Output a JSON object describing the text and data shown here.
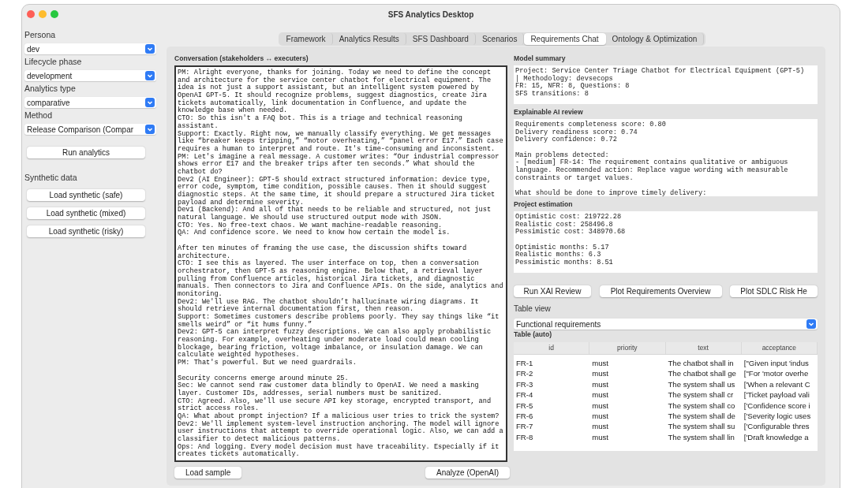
{
  "window": {
    "title": "SFS Analytics Desktop"
  },
  "sidebar": {
    "fields": [
      {
        "label": "Persona",
        "value": "dev"
      },
      {
        "label": "Lifecycle phase",
        "value": "development"
      },
      {
        "label": "Analytics type",
        "value": "comparative"
      },
      {
        "label": "Method",
        "value": "Release Comparison (Compar"
      }
    ],
    "run_button": "Run analytics",
    "synthetic": {
      "label": "Synthetic data",
      "buttons": [
        "Load synthetic (safe)",
        "Load synthetic (mixed)",
        "Load synthetic (risky)"
      ]
    }
  },
  "tabs": [
    {
      "label": "Framework",
      "selected": false
    },
    {
      "label": "Analytics Results",
      "selected": false
    },
    {
      "label": "SFS Dashboard",
      "selected": false
    },
    {
      "label": "Scenarios",
      "selected": false
    },
    {
      "label": "Requirements Chat",
      "selected": true
    },
    {
      "label": "Ontology & Optimization",
      "selected": false
    }
  ],
  "conversation": {
    "title": "Conversation (stakeholders ↔ executers)",
    "sections": [
      [
        "PM: Alright everyone, thanks for joining. Today we need to define the concept and architecture for the service center chatbot for electrical equipment. The idea is not just a support assistant, but an intelligent system powered by OpenAI GPT-5. It should recognize problems, suggest diagnostics, create Jira tickets automatically, link documentation in Confluence, and update the knowledge base when needed.",
        "CTO: So this isn't a FAQ bot. This is a triage and technical reasoning assistant.",
        "Support: Exactly. Right now, we manually classify everything. We get messages like “breaker keeps tripping,” “motor overheating,” “panel error E17.” Each case requires a human to interpret and route. It's time-consuming and inconsistent.",
        "PM: Let's imagine a real message. A customer writes: “Our industrial compressor shows error E17 and the breaker trips after ten seconds.” What should the chatbot do?",
        "Dev2 (AI Engineer): GPT-5 should extract structured information: device type, error code, symptom, time condition, possible causes. Then it should suggest diagnostic steps. At the same time, it should prepare a structured Jira ticket payload and determine severity.",
        "Dev1 (Backend): And all of that needs to be reliable and structured, not just natural language. We should use structured output mode with JSON.",
        "CTO: Yes. No free-text chaos. We want machine-readable reasoning.",
        "QA: And confidence score. We need to know how certain the model is."
      ],
      [
        "After ten minutes of framing the use case, the discussion shifts toward architecture.",
        "CTO: I see this as layered. The user interface on top, then a conversation orchestrator, then GPT-5 as reasoning engine. Below that, a retrieval layer pulling from Confluence articles, historical Jira tickets, and diagnostic manuals. Then connectors to Jira and Confluence APIs. On the side, analytics and monitoring.",
        "Dev2: We'll use RAG. The chatbot shouldn’t hallucinate wiring diagrams. It should retrieve internal documentation first, then reason.",
        "Support: Sometimes customers describe problems poorly. They say things like “it smells weird” or “it hums funny.”",
        "Dev2: GPT-5 can interpret fuzzy descriptions. We can also apply probabilistic reasoning. For example, overheating under moderate load could mean cooling blockage, bearing friction, voltage imbalance, or insulation damage. We can calculate weighted hypotheses.",
        "PM: That's powerful. But we need guardrails."
      ],
      [
        "Security concerns emerge around minute 25.",
        "Sec: We cannot send raw customer data blindly to OpenAI. We need a masking layer. Customer IDs, addresses, serial numbers must be sanitized.",
        "CTO: Agreed. Also, we'll use secure API key storage, encrypted transport, and strict access roles.",
        "QA: What about prompt injection? If a malicious user tries to trick the system?",
        "Dev2: We'll implement system-level instruction anchoring. The model will ignore user instructions that attempt to override operational logic. Also, we can add a classifier to detect malicious patterns.",
        "Ops: And logging. Every model decision must have traceability. Especially if it creates tickets automatically."
      ]
    ],
    "buttons": [
      "Load sample",
      "Analyze (OpenAI)"
    ]
  },
  "panels": [
    {
      "title": "Model summary",
      "paragraphs": [
        [
          "Project: Service Center Triage Chatbot for Electrical Equipment (GPT-5)",
          "| Methodology: devsecops",
          "FR: 15, NFR: 8, Questions: 8",
          "SFS transitions: 8"
        ]
      ]
    },
    {
      "title": "Explainable AI review",
      "paragraphs": [
        [
          "Requirements completeness score: 0.80",
          "Delivery readiness score: 0.74",
          "Delivery confidence: 0.72"
        ],
        [
          "Main problems detected:",
          "- [medium] FR-14: The requirement contains qualitative or ambiguous",
          "language. Recommended action: Replace vague wording with measurable",
          "constraints or target values."
        ],
        [
          "What should be done to improve timely delivery:"
        ]
      ]
    },
    {
      "title": "Project estimation",
      "paragraphs": [
        [
          "Optimistic cost: 219722.28",
          "Realistic cost: 258496.8",
          "Pessimistic cost: 348970.68"
        ],
        [
          "Optimistic months: 5.17",
          "Realistic months: 6.3",
          "Pessimistic months: 8.51"
        ]
      ]
    }
  ],
  "actions": [
    "Run XAI Review",
    "Plot Requirements Overview",
    "Plot SDLC Risk He"
  ],
  "table_view": {
    "label": "Table view",
    "value": "Functional requirements"
  },
  "table": {
    "title": "Table (auto)",
    "columns": [
      "id",
      "priority",
      "text",
      "acceptance"
    ],
    "rows": [
      [
        "FR-1",
        "must",
        "The chatbot shall in",
        "[\"Given input 'indus"
      ],
      [
        "FR-2",
        "must",
        "The chatbot shall ge",
        "[\"For 'motor overhe"
      ],
      [
        "FR-3",
        "must",
        "The system shall us",
        "['When a relevant C"
      ],
      [
        "FR-4",
        "must",
        "The system shall cr",
        "['Ticket payload vali"
      ],
      [
        "FR-5",
        "must",
        "The system shall co",
        "['Confidence score i"
      ],
      [
        "FR-6",
        "must",
        "The system shall de",
        "['Severity logic uses"
      ],
      [
        "FR-7",
        "must",
        "The system shall su",
        "['Configurable thres"
      ],
      [
        "FR-8",
        "must",
        "The system shall lin",
        "['Draft knowledge a"
      ]
    ]
  }
}
